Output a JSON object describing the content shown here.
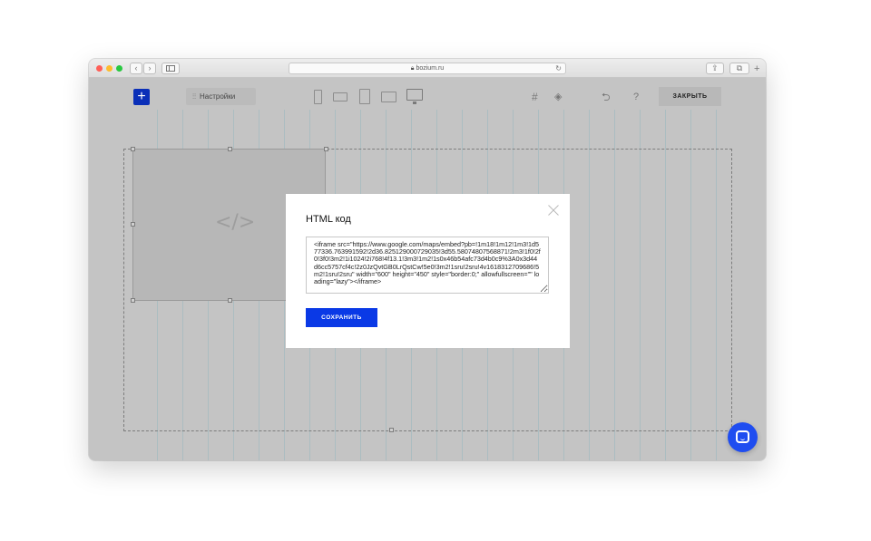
{
  "browser": {
    "url": "bozium.ru",
    "back_glyph": "‹",
    "forward_glyph": "›",
    "plus_tab": "+"
  },
  "toolbar": {
    "add_label": "+",
    "settings_label": "Настройки",
    "close_label": "ЗАКРЫТЬ",
    "help_label": "?",
    "icons": [
      "plus-icon",
      "sliders-icon",
      "phone-icon",
      "phone-landscape-icon",
      "tablet-icon",
      "tablet-landscape-icon",
      "desktop-icon",
      "grid-icon",
      "layers-icon",
      "undo-icon",
      "help-icon"
    ]
  },
  "canvas": {
    "code_glyph": "</>",
    "colors": {
      "accent": "#0a39e6",
      "overlay": "#c4c4c4",
      "chat": "#1f4df0"
    }
  },
  "modal": {
    "title": "HTML код",
    "code_value": "<iframe src=\"https://www.google.com/maps/embed?pb=!1m18!1m12!1m3!1d577336.763991592!2d36.825129000729035!3d55.58074807568871!2m3!1f0!2f0!3f0!3m2!1i1024!2i768!4f13.1!3m3!1m2!1s0x46b54afc73d4b0c9%3A0x3d44d6cc5757cf4c!2z0JzQvtGB0LrQstCw!5e0!3m2!1sru!2sru!4v1618312709686!5m2!1sru!2sru\" width=\"600\" height=\"450\" style=\"border:0;\" allowfullscreen=\"\" loading=\"lazy\"></iframe>",
    "save_label": "СОХРАНИТЬ",
    "close_glyph": "╳"
  }
}
